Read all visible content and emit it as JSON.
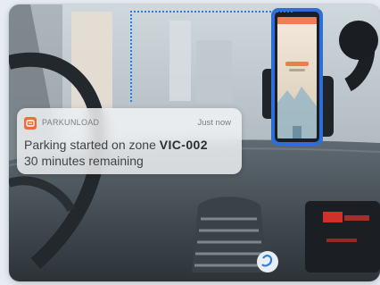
{
  "notification": {
    "app_name": "PARKUNLOAD",
    "time": "Just now",
    "message_prefix": "Parking started on zone ",
    "zone_code": "VIC-002",
    "remaining": "30 minutes remaining"
  },
  "icons": {
    "app": "parkunload-app-icon",
    "dashboard_button": "dashboard-button-icon"
  },
  "colors": {
    "accent_orange": "#f06a3b",
    "guide_blue": "#2d7bdc",
    "display_red": "#e2342b"
  }
}
